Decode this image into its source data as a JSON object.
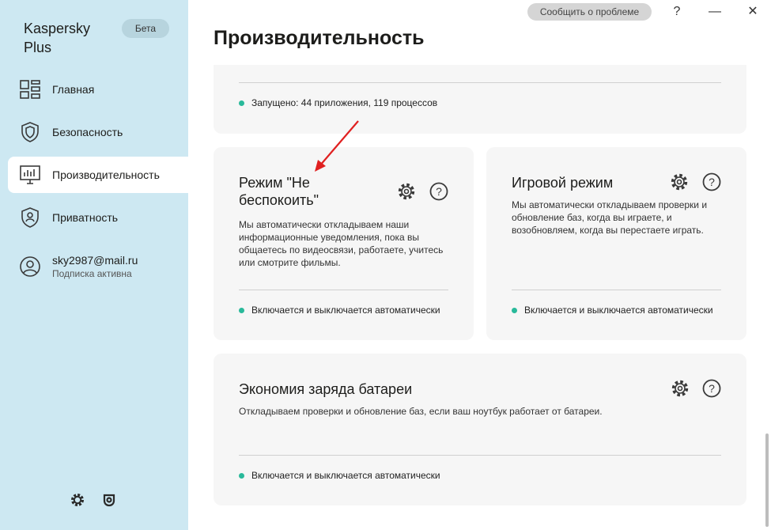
{
  "app": {
    "name": "Kaspersky Plus",
    "badge": "Бета"
  },
  "sidebar": {
    "items": [
      {
        "label": "Главная",
        "icon": "grid-icon"
      },
      {
        "label": "Безопасность",
        "icon": "shield-icon"
      },
      {
        "label": "Производительность",
        "icon": "performance-icon",
        "active": true
      },
      {
        "label": "Приватность",
        "icon": "privacy-shield-icon"
      }
    ],
    "account": {
      "email": "sky2987@mail.ru",
      "status": "Подписка активна",
      "icon": "user-icon"
    },
    "bottom_icons": [
      "settings-icon",
      "support-icon"
    ]
  },
  "topbar": {
    "report_label": "Сообщить о проблеме",
    "help": "?",
    "minimize": "—",
    "close": "✕"
  },
  "page": {
    "title": "Производительность"
  },
  "cards": {
    "running": {
      "status": "Запущено: 44 приложения, 119 процессов"
    },
    "dnd": {
      "title": "Режим \"Не беспокоить\"",
      "description": "Мы автоматически откладываем наши информационные уведомления, пока вы общаетесь по видеосвязи, работаете, учитесь или смотрите фильмы.",
      "status": "Включается и выключается автоматически"
    },
    "game": {
      "title": "Игровой режим",
      "description": "Мы автоматически откладываем проверки и обновление баз, когда вы играете, и возобновляем, когда вы перестаете играть.",
      "status": "Включается и выключается автоматически"
    },
    "battery": {
      "title": "Экономия заряда батареи",
      "description": "Откладываем проверки и обновление баз, если ваш ноутбук работает от батареи.",
      "status": "Включается и выключается автоматически"
    }
  },
  "colors": {
    "sidebar_bg": "#cde8f2",
    "status_dot": "#29b99a",
    "arrow": "#e02020",
    "card_bg": "#f6f6f6"
  }
}
